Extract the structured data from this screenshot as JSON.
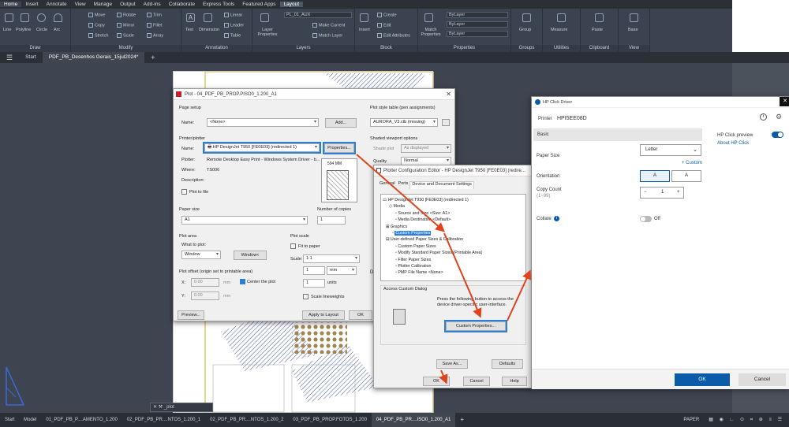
{
  "ribbon": {
    "tabs": [
      "Home",
      "Insert",
      "Annotate",
      "View",
      "Manage",
      "Output",
      "Add-ins",
      "Collaborate",
      "Express Tools",
      "Featured Apps",
      "Layout"
    ],
    "groups": {
      "draw": "Draw",
      "modify": "Modify",
      "annotation": "Annotation",
      "layers": "Layers",
      "block": "Block",
      "properties": "Properties",
      "groups": "Groups",
      "utilities": "Utilities",
      "clipboard": "Clipboard",
      "view": "View"
    },
    "draw_tools": [
      "Line",
      "Polyline",
      "Circle",
      "Arc"
    ],
    "modify_tools": [
      "Move",
      "Rotate",
      "Trim",
      "Copy",
      "Mirror",
      "Fillet",
      "Stretch",
      "Scale",
      "Array"
    ],
    "annotation_tools": [
      "Text",
      "Dimension",
      "Linear",
      "Leader",
      "Table"
    ],
    "layer_tools": [
      "Layer Properties",
      "Make Current",
      "Match Layer"
    ],
    "layer_name": "PL_01_AUX",
    "block_tools": [
      "Insert",
      "Create",
      "Edit",
      "Edit Attributes"
    ],
    "properties_tools": [
      "Match Properties"
    ],
    "prop_values": [
      "ByLayer",
      "ByLayer",
      "ByLayer"
    ],
    "other": {
      "group": "Group",
      "measure": "Measure",
      "paste": "Paste",
      "base": "Base"
    }
  },
  "doc_tabs": {
    "start": "Start",
    "active": "PDF_PB_Desenhos Gerais_15jul2024*"
  },
  "plot": {
    "title": "Plot - 04_PDF_PB_PROP.PISO0_1.200_A1",
    "page_setup": "Page setup",
    "name_lbl": "Name:",
    "name_val": "<None>",
    "add_btn": "Add...",
    "printer_section": "Printer/plotter",
    "printer_name": "HP DesignJet T950 [FE0E03] (redirected 1)",
    "properties_btn": "Properties...",
    "plotter_lbl": "Plotter:",
    "plotter_val": "Remote Desktop Easy Print - Windows System Driver - b...",
    "where_lbl": "Where:",
    "where_val": "TS006",
    "desc_lbl": "Description:",
    "plot_to_file": "Plot to file",
    "preview_dim": "594 MM",
    "paper_size_lbl": "Paper size",
    "paper_size_val": "A1",
    "copies_lbl": "Number of copies",
    "copies_val": "1",
    "plot_area_lbl": "Plot area",
    "what_to_plot": "What to plot:",
    "window_val": "Window",
    "window_btn": "Window<",
    "offset_lbl": "Plot offset (origin set to printable area)",
    "x_lbl": "X:",
    "x_val": "0.00",
    "y_lbl": "Y:",
    "y_val": "0.00",
    "mm": "mm",
    "center": "Center the plot",
    "scale_lbl": "Plot scale",
    "fit_paper": "Fit to paper",
    "scale_field": "Scale:",
    "scale_val": "1:1",
    "scale_a": "1",
    "scale_unit": "mm",
    "scale_b": "1",
    "units": "units",
    "scale_lw": "Scale lineweights",
    "style_table_lbl": "Plot style table (pen assignments)",
    "style_val": "AURORA_V3.ctb (missing)",
    "shaded_lbl": "Shaded viewport options",
    "shade_plot": "Shade plot",
    "shade_val": "As displayed",
    "quality_lbl": "Quality",
    "quality_val": "Normal",
    "preview_btn": "Preview...",
    "apply_btn": "Apply to Layout",
    "ok_btn": "OK"
  },
  "pce": {
    "title": "Plotter Configuration Editor - HP DesignJet T950 [FE0E03] (redire...",
    "tabs": [
      "General",
      "Ports",
      "Device and Document Settings"
    ],
    "tree": [
      "HP DesignJet T950 [FE0E03] (redirected 1)",
      "Media",
      "Source and Size <Size: A1>",
      "Media Destination <Default>",
      "Graphics",
      "Custom Properties",
      "User-defined Paper Sizes & Calibration",
      "Custom Paper Sizes",
      "Modify Standard Paper Sizes (Printable Area)",
      "Filter Paper Sizes",
      "Plotter Calibration",
      "PMP File Name <None>"
    ],
    "access_lbl": "Access Custom Dialog",
    "access_desc": "Press the following button to access the device driver-specific user-interface.",
    "custom_btn": "Custom Properties...",
    "save_as": "Save As...",
    "defaults": "Defaults",
    "ok": "OK",
    "cancel": "Cancel",
    "help": "Help"
  },
  "hp": {
    "title": "HP Click Driver",
    "printer_lbl": "Printer",
    "printer_val": "HPI5EE08D",
    "basic": "Basic",
    "preview_lbl": "HP Click preview",
    "about": "About HP Click",
    "paper_size_lbl": "Paper Size",
    "paper_size_val": "Letter",
    "custom": "+ Custom",
    "orientation_lbl": "Orientation",
    "copy_lbl": "Copy Count",
    "copy_range": "(1~99)",
    "copy_val": "1",
    "minus": "−",
    "plus": "+",
    "collate_lbl": "Collate",
    "collate_state": "Off",
    "ok": "OK",
    "cancel": "Cancel"
  },
  "status": {
    "layouts": [
      "Model",
      "01_PDF_PB_P....AMENTO_1.200",
      "02_PDF_PB_PR....NTOS_1.200_1",
      "02_PDF_PB_PR....NTOS_1.200_2",
      "03_PDF_PB_PROP.FOTOS_1.200",
      "04_PDF_PB_PR....ISO0_1.200_A1"
    ],
    "paper": "PAPER",
    "command_placeholder": "_plot",
    "start": "Start"
  },
  "accent": "#2c7fd8",
  "arrow_color": "#e0441b"
}
